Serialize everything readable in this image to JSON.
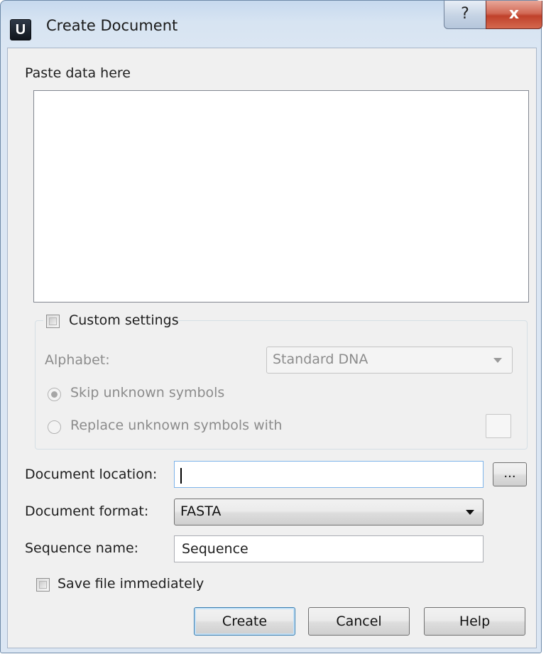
{
  "window": {
    "icon_letter": "U",
    "title": "Create Document",
    "help_glyph": "?",
    "close_glyph": "x"
  },
  "paste": {
    "label": "Paste data here",
    "content": ""
  },
  "custom_settings": {
    "label": "Custom settings",
    "checked": false,
    "alphabet_label": "Alphabet:",
    "alphabet_value": "Standard DNA",
    "skip_label": "Skip unknown symbols",
    "replace_label": "Replace unknown symbols with",
    "replace_value": ""
  },
  "form": {
    "location_label": "Document location:",
    "location_value": "",
    "browse_label": "...",
    "format_label": "Document format:",
    "format_value": "FASTA",
    "name_label": "Sequence name:",
    "name_value": "Sequence",
    "save_label": "Save file immediately",
    "save_checked": false
  },
  "buttons": {
    "create": "Create",
    "cancel": "Cancel",
    "help": "Help"
  },
  "colors": {
    "focus_border": "#7eb4ea",
    "close_red": "#c0412b",
    "disabled_text": "#8c8c8c"
  }
}
